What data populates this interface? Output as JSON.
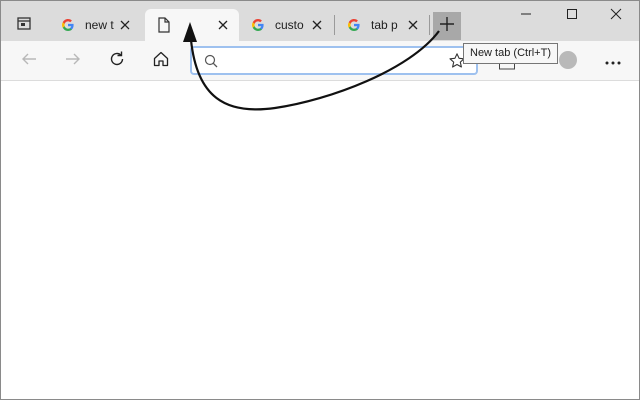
{
  "tabs": [
    {
      "title": "new t",
      "favicon": "google-g-icon",
      "active": false
    },
    {
      "title": "",
      "favicon": "blank-page-icon",
      "active": true
    },
    {
      "title": "custo",
      "favicon": "google-g-icon",
      "active": false
    },
    {
      "title": "tab p",
      "favicon": "google-g-icon",
      "active": false
    }
  ],
  "tooltip": {
    "text": "New tab (Ctrl+T)"
  },
  "addressbar": {
    "value": "",
    "placeholder": ""
  },
  "colors": {
    "tabstrip": "#dcdcdc",
    "active_tab": "#f7f7f7",
    "newtab_hover": "#a8a8a8",
    "address_focus_border": "#9ec1ef",
    "annotation_arrow": "#111111"
  },
  "icons": [
    "tab-actions-icon",
    "google-g-icon",
    "blank-page-icon",
    "close-icon",
    "plus-icon",
    "minimize-icon",
    "maximize-icon",
    "close-window-icon",
    "back-icon",
    "forward-icon",
    "refresh-icon",
    "home-icon",
    "search-icon",
    "star-icon",
    "collections-icon",
    "profile-avatar",
    "more-icon"
  ]
}
